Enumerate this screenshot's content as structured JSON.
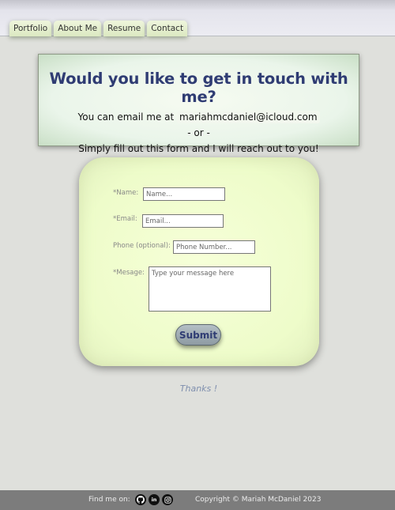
{
  "nav": {
    "items": [
      {
        "label": "Portfolio"
      },
      {
        "label": "About Me"
      },
      {
        "label": "Resume"
      },
      {
        "label": "Contact"
      }
    ]
  },
  "banner": {
    "title": "Would you like to get in touch with me?",
    "email_prefix": "You can email me at",
    "email": "mariahmcdaniel@icloud.com",
    "separator": "- or -",
    "form_prompt": "Simply fill out this form and I will reach out to you!"
  },
  "form": {
    "name_label": "*Name:",
    "name_placeholder": "Name...",
    "email_label": "*Email:",
    "email_placeholder": "Email...",
    "phone_label": "Phone (optional):",
    "phone_placeholder": "Phone Number...",
    "message_label": "*Mesage:",
    "message_placeholder": "Type your message here",
    "submit_label": "Submit"
  },
  "thanks": "Thanks !",
  "footer": {
    "find_me": "Find me on:",
    "social_icons": [
      "github-icon",
      "linkedin-icon",
      "instagram-icon"
    ],
    "linkedin_text": "in",
    "copyright": "Copyright © Mariah McDaniel 2023"
  },
  "colors": {
    "page_background": "#dfe0dc",
    "title": "#2f3c73",
    "card_background": "#eefcca",
    "footer_background": "#7c7c7c",
    "thanks_text": "#7f8fae"
  }
}
